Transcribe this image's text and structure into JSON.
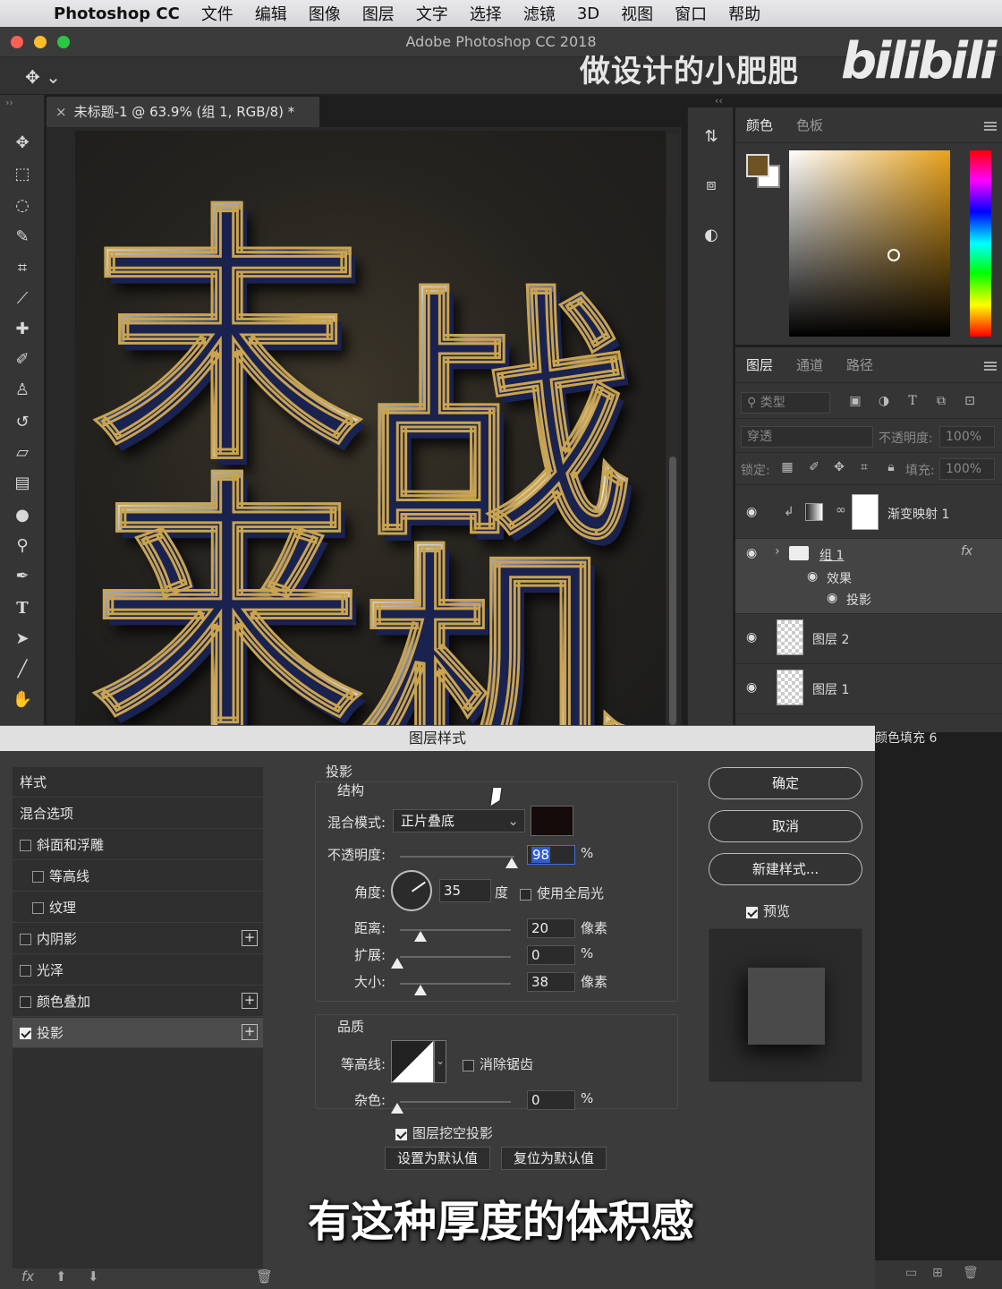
{
  "macos_menu": {
    "app_name": "Photoshop CC",
    "items": [
      "文件",
      "编辑",
      "图像",
      "图层",
      "文字",
      "选择",
      "滤镜",
      "3D",
      "视图",
      "窗口",
      "帮助"
    ]
  },
  "window": {
    "title": "Adobe Photoshop CC 2018"
  },
  "watermark": {
    "channel": "做设计的小肥肥",
    "logo": "bilibili"
  },
  "document_tab": {
    "title": "未标题-1 @ 63.9% (组 1, RGB/8) *"
  },
  "canvas_art": {
    "chars": [
      "末",
      "战",
      "来",
      "机"
    ]
  },
  "tools": [
    "move-icon",
    "marquee-icon",
    "lasso-icon",
    "quick-select-icon",
    "crop-icon",
    "eyedropper-icon",
    "healing-icon",
    "brush-icon",
    "stamp-icon",
    "history-brush-icon",
    "eraser-icon",
    "gradient-icon",
    "blur-icon",
    "dodge-icon",
    "pen-icon",
    "type-icon",
    "path-select-icon",
    "line-icon",
    "hand-icon"
  ],
  "color_panel": {
    "tabs": [
      "颜色",
      "色板"
    ],
    "foreground": "#6e5224",
    "background": "#ffffff"
  },
  "layers_panel": {
    "tabs": [
      "图层",
      "通道",
      "路径"
    ],
    "filter_label": "类型",
    "blend_mode": "穿透",
    "opacity_label": "不透明度:",
    "opacity_value": "100%",
    "lock_label": "锁定:",
    "fill_label": "填充:",
    "fill_value": "100%",
    "layers": [
      {
        "name": "渐变映射 1"
      },
      {
        "name": "组 1",
        "fx": "fx"
      },
      {
        "name": "效果"
      },
      {
        "name": "投影"
      },
      {
        "name": "图层 2"
      },
      {
        "name": "图层 1"
      },
      {
        "name": "颜色填充 6"
      }
    ]
  },
  "dialog": {
    "title": "图层样式",
    "styles": [
      {
        "label": "样式"
      },
      {
        "label": "混合选项"
      },
      {
        "label": "斜面和浮雕",
        "checked": false
      },
      {
        "label": "等高线",
        "checked": false
      },
      {
        "label": "纹理",
        "checked": false
      },
      {
        "label": "内阴影",
        "checked": false
      },
      {
        "label": "光泽",
        "checked": false
      },
      {
        "label": "颜色叠加",
        "checked": false
      },
      {
        "label": "投影",
        "checked": true
      }
    ],
    "section_title": "投影",
    "structure": {
      "title": "结构",
      "blend_mode_label": "混合模式:",
      "blend_mode_value": "正片叠底",
      "shadow_color": "#150b0b",
      "opacity_label": "不透明度:",
      "opacity_value": "98",
      "opacity_pct": 98,
      "angle_label": "角度:",
      "angle_value": "35",
      "angle_unit": "度",
      "global_light_label": "使用全局光",
      "distance_label": "距离:",
      "distance_value": "20",
      "distance_unit": "像素",
      "spread_label": "扩展:",
      "spread_value": "0",
      "size_label": "大小:",
      "size_value": "38",
      "size_unit": "像素",
      "percent": "%"
    },
    "quality": {
      "title": "品质",
      "contour_label": "等高线:",
      "antialias_label": "消除锯齿",
      "noise_label": "杂色:",
      "noise_value": "0",
      "percent": "%"
    },
    "knockout_label": "图层挖空投影",
    "set_default_label": "设置为默认值",
    "reset_default_label": "复位为默认值",
    "ok_label": "确定",
    "cancel_label": "取消",
    "new_style_label": "新建样式...",
    "preview_label": "预览",
    "footer_fx": "fx"
  },
  "subtitle": "有这种厚度的体积感"
}
